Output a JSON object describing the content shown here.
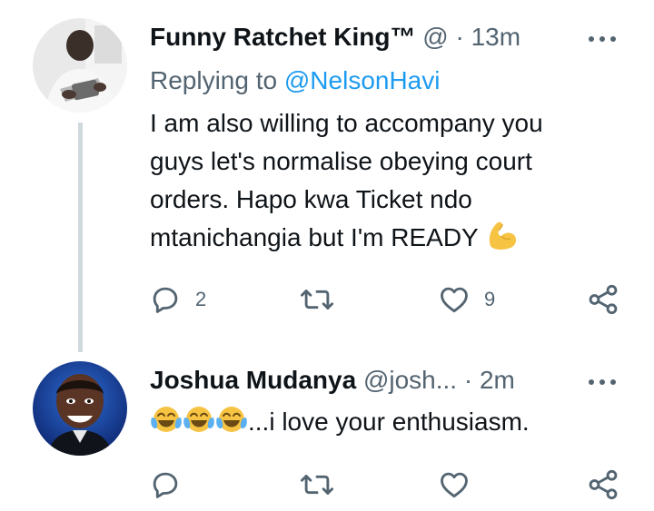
{
  "colors": {
    "text": "#0f1419",
    "secondary": "#536471",
    "link": "#1d9bf0",
    "thread_line": "#cfd9de",
    "flex_emoji": "#f6c343"
  },
  "tweets": [
    {
      "name": "Funny Ratchet King™",
      "handle": "@",
      "separator": "·",
      "time": "13m",
      "replying_prefix": "Replying to",
      "replying_handle": "@NelsonHavi",
      "text_lines": [
        "I am also willing to accompany you",
        "guys let's normalise obeying court",
        "orders. Hapo kwa Ticket ndo",
        "mtanichangia but I'm READY"
      ],
      "emoji": "flexed-biceps-emoji",
      "actions": {
        "reply_count": "2",
        "retweet_count": "",
        "like_count": "9"
      }
    },
    {
      "name": "Joshua Mudanya",
      "handle": "@josh...",
      "separator": "·",
      "time": "2m",
      "text": "...i love your enthusiasm.",
      "emoji": "face-with-tears-of-joy-emoji",
      "emoji_count": 3,
      "actions": {
        "reply_count": "",
        "retweet_count": "",
        "like_count": ""
      }
    }
  ]
}
